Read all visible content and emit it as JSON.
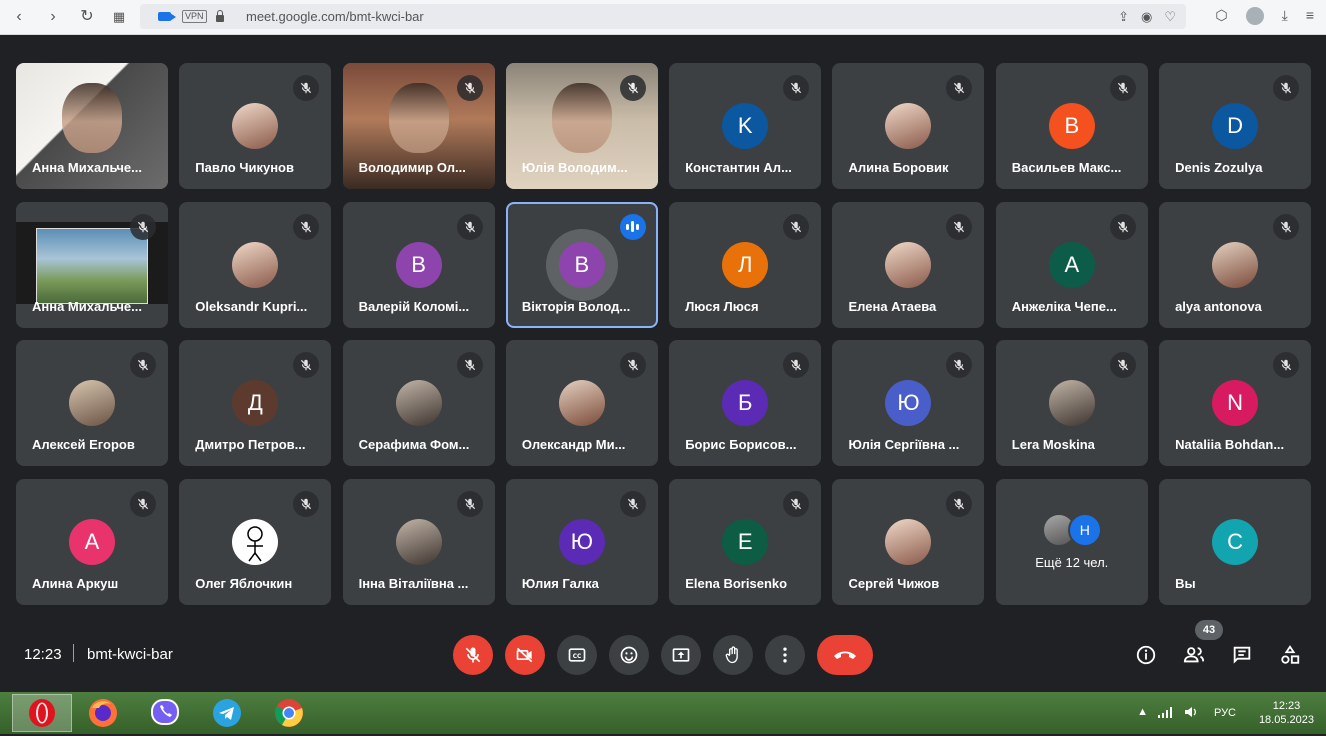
{
  "browser": {
    "url_host": "meet.google.com",
    "url_path": "/bmt-kwci-bar",
    "vpn_label": "VPN"
  },
  "tiles": [
    {
      "name": "Анна Михальче...",
      "type": "video",
      "muted": false
    },
    {
      "name": "Павло Чикунов",
      "type": "photo",
      "muted": true
    },
    {
      "name": "Володимир Ол...",
      "type": "video",
      "muted": true
    },
    {
      "name": "Юлія Володим...",
      "type": "video",
      "muted": true
    },
    {
      "name": "Константин Ал...",
      "type": "letter",
      "letter": "K",
      "color": "#0b57a0",
      "muted": true
    },
    {
      "name": "Алина Боровик",
      "type": "photo",
      "muted": true
    },
    {
      "name": "Васильев Макс...",
      "type": "letter",
      "letter": "B",
      "color": "#f4511e",
      "muted": true
    },
    {
      "name": "Denis Zozulya",
      "type": "letter",
      "letter": "D",
      "color": "#0b57a0",
      "muted": true
    },
    {
      "name": "Анна Михальче...",
      "type": "screen",
      "muted": true
    },
    {
      "name": "Oleksandr Kupri...",
      "type": "photo",
      "muted": true
    },
    {
      "name": "Валерій Коломі...",
      "type": "letter",
      "letter": "B",
      "color": "#8e44ad",
      "muted": true
    },
    {
      "name": "Вікторія Волод...",
      "type": "letter",
      "letter": "B",
      "color": "#8e44ad",
      "muted": false,
      "speaking": true
    },
    {
      "name": "Люся Люся",
      "type": "letter",
      "letter": "Л",
      "color": "#e8710a",
      "muted": true
    },
    {
      "name": "Елена Атаева",
      "type": "photo",
      "muted": true
    },
    {
      "name": "Анжеліка Чепе...",
      "type": "letter",
      "letter": "A",
      "color": "#0d5c4a",
      "muted": true
    },
    {
      "name": "alya antonova",
      "type": "photo",
      "muted": true
    },
    {
      "name": "Алексей Егоров",
      "type": "photo",
      "muted": true
    },
    {
      "name": "Дмитро Петров...",
      "type": "letter",
      "letter": "Д",
      "color": "#5d3a2e",
      "muted": true
    },
    {
      "name": "Серафима Фом...",
      "type": "photo",
      "muted": true
    },
    {
      "name": "Олександр Ми...",
      "type": "photo",
      "muted": true
    },
    {
      "name": "Борис Борисов...",
      "type": "letter",
      "letter": "Б",
      "color": "#5b2bb5",
      "muted": true
    },
    {
      "name": "Юлія Сергіївна ...",
      "type": "letter",
      "letter": "Ю",
      "color": "#4a5ec9",
      "muted": true
    },
    {
      "name": "Lera Moskina",
      "type": "photo",
      "muted": true
    },
    {
      "name": "Nataliia Bohdan...",
      "type": "letter",
      "letter": "N",
      "color": "#d81b60",
      "muted": true
    },
    {
      "name": "Алина Аркуш",
      "type": "letter",
      "letter": "A",
      "color": "#e8336d",
      "muted": true
    },
    {
      "name": "Олег Яблочкин",
      "type": "sketch",
      "muted": true
    },
    {
      "name": "Інна Віталіївна ...",
      "type": "photo",
      "muted": true
    },
    {
      "name": "Юлия Галка",
      "type": "letter",
      "letter": "Ю",
      "color": "#5b2bb5",
      "muted": true
    },
    {
      "name": "Elena Borisenko",
      "type": "letter",
      "letter": "E",
      "color": "#0d5c44",
      "muted": true
    },
    {
      "name": "Сергей Чижов",
      "type": "photo",
      "muted": true
    },
    {
      "name": "",
      "type": "more",
      "more_letter": "H",
      "more_text": "Ещё 12 чел.",
      "muted": false
    },
    {
      "name": "Вы",
      "type": "letter",
      "letter": "C",
      "color": "#12a4af",
      "muted": false
    }
  ],
  "bottom_bar": {
    "time": "12:23",
    "meeting_code": "bmt-kwci-bar",
    "participants_count": "43"
  },
  "taskbar": {
    "language": "РУС",
    "clock_time": "12:23",
    "clock_date": "18.05.2023"
  },
  "colors": {
    "background": "#202124",
    "tile": "#3c4043",
    "danger": "#ea4335",
    "accent": "#1a73e8"
  }
}
